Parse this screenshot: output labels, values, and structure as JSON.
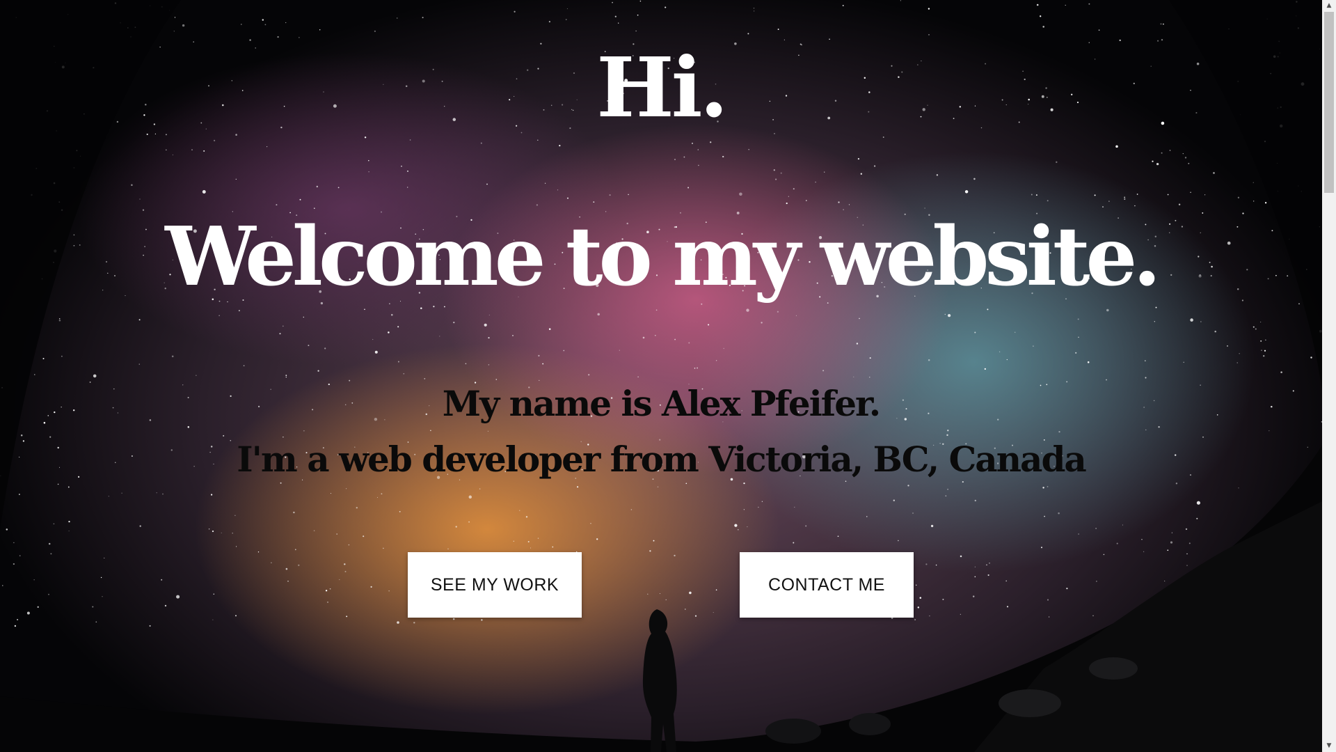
{
  "hero": {
    "greeting": "Hi.",
    "headline": "Welcome to my website.",
    "name_line": "My name is Alex Pfeifer.",
    "location_line": "I'm a web developer from Victoria, BC, Canada"
  },
  "actions": {
    "see_work_label": "SEE MY WORK",
    "contact_label": "CONTACT ME"
  },
  "background": {
    "image": "starry-night-sky-milky-way-with-silhouette-person",
    "colors": {
      "sky_pink": "#d6608c",
      "sky_orange": "#eb963c",
      "sky_teal": "#60a0aa",
      "edge_dark": "#050507"
    }
  },
  "scrollbar": {
    "up_icon": "scroll-up-arrow-icon",
    "down_icon": "scroll-down-arrow-icon"
  }
}
